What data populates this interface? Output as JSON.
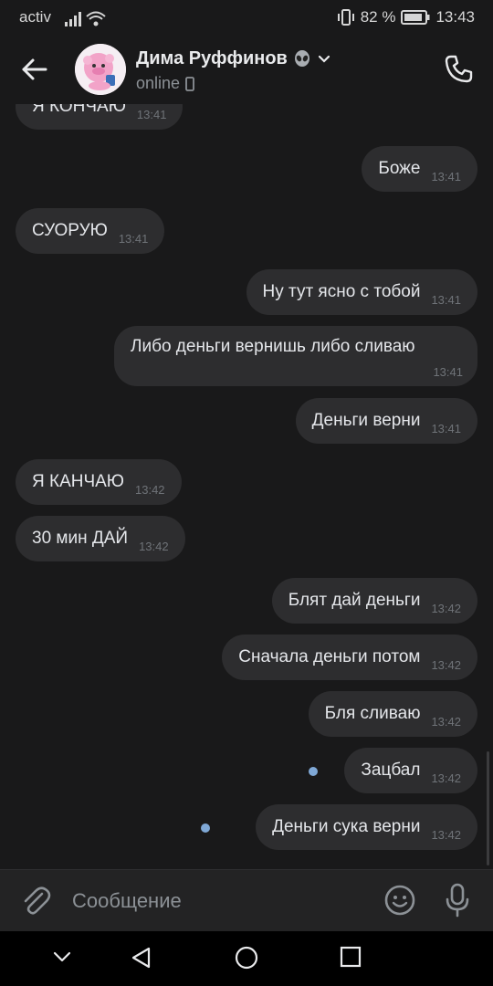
{
  "statusbar": {
    "carrier": "activ",
    "battery": "82 %",
    "time": "13:43"
  },
  "header": {
    "name": "Дима Руффинов",
    "status": "online"
  },
  "messages": [
    {
      "text": "Я КОНЧАЮ",
      "time": "13:41",
      "side": "in"
    },
    {
      "text": "Боже",
      "time": "13:41",
      "side": "out"
    },
    {
      "text": "СУОРУЮ",
      "time": "13:41",
      "side": "in"
    },
    {
      "text": "Ну тут ясно с тобой",
      "time": "13:41",
      "side": "out"
    },
    {
      "text": "Либо деньги вернишь либо сливаю",
      "time": "13:41",
      "side": "out"
    },
    {
      "text": "Деньги верни",
      "time": "13:41",
      "side": "out"
    },
    {
      "text": "Я КАНЧАЮ",
      "time": "13:42",
      "side": "in"
    },
    {
      "text": "30 мин ДАЙ",
      "time": "13:42",
      "side": "in"
    },
    {
      "text": "Блят дай деньги",
      "time": "13:42",
      "side": "out"
    },
    {
      "text": "Сначала деньги потом",
      "time": "13:42",
      "side": "out"
    },
    {
      "text": "Бля сливаю",
      "time": "13:42",
      "side": "out"
    },
    {
      "text": "Зацбал",
      "time": "13:42",
      "side": "out",
      "unread": true
    },
    {
      "text": "Деньги сука верни",
      "time": "13:42",
      "side": "out",
      "unread": true
    }
  ],
  "composer": {
    "placeholder": "Сообщение"
  },
  "icons": {
    "back": "arrow-left-icon",
    "call": "phone-icon",
    "attach": "paperclip-icon",
    "emoji": "smile-icon",
    "mic": "microphone-icon",
    "alien": "alien-emoji-icon",
    "device": "mobile-device-icon"
  },
  "colors": {
    "background": "#19191a",
    "bubble": "#2d2d2f",
    "unread_dot": "#7fa8d6"
  }
}
